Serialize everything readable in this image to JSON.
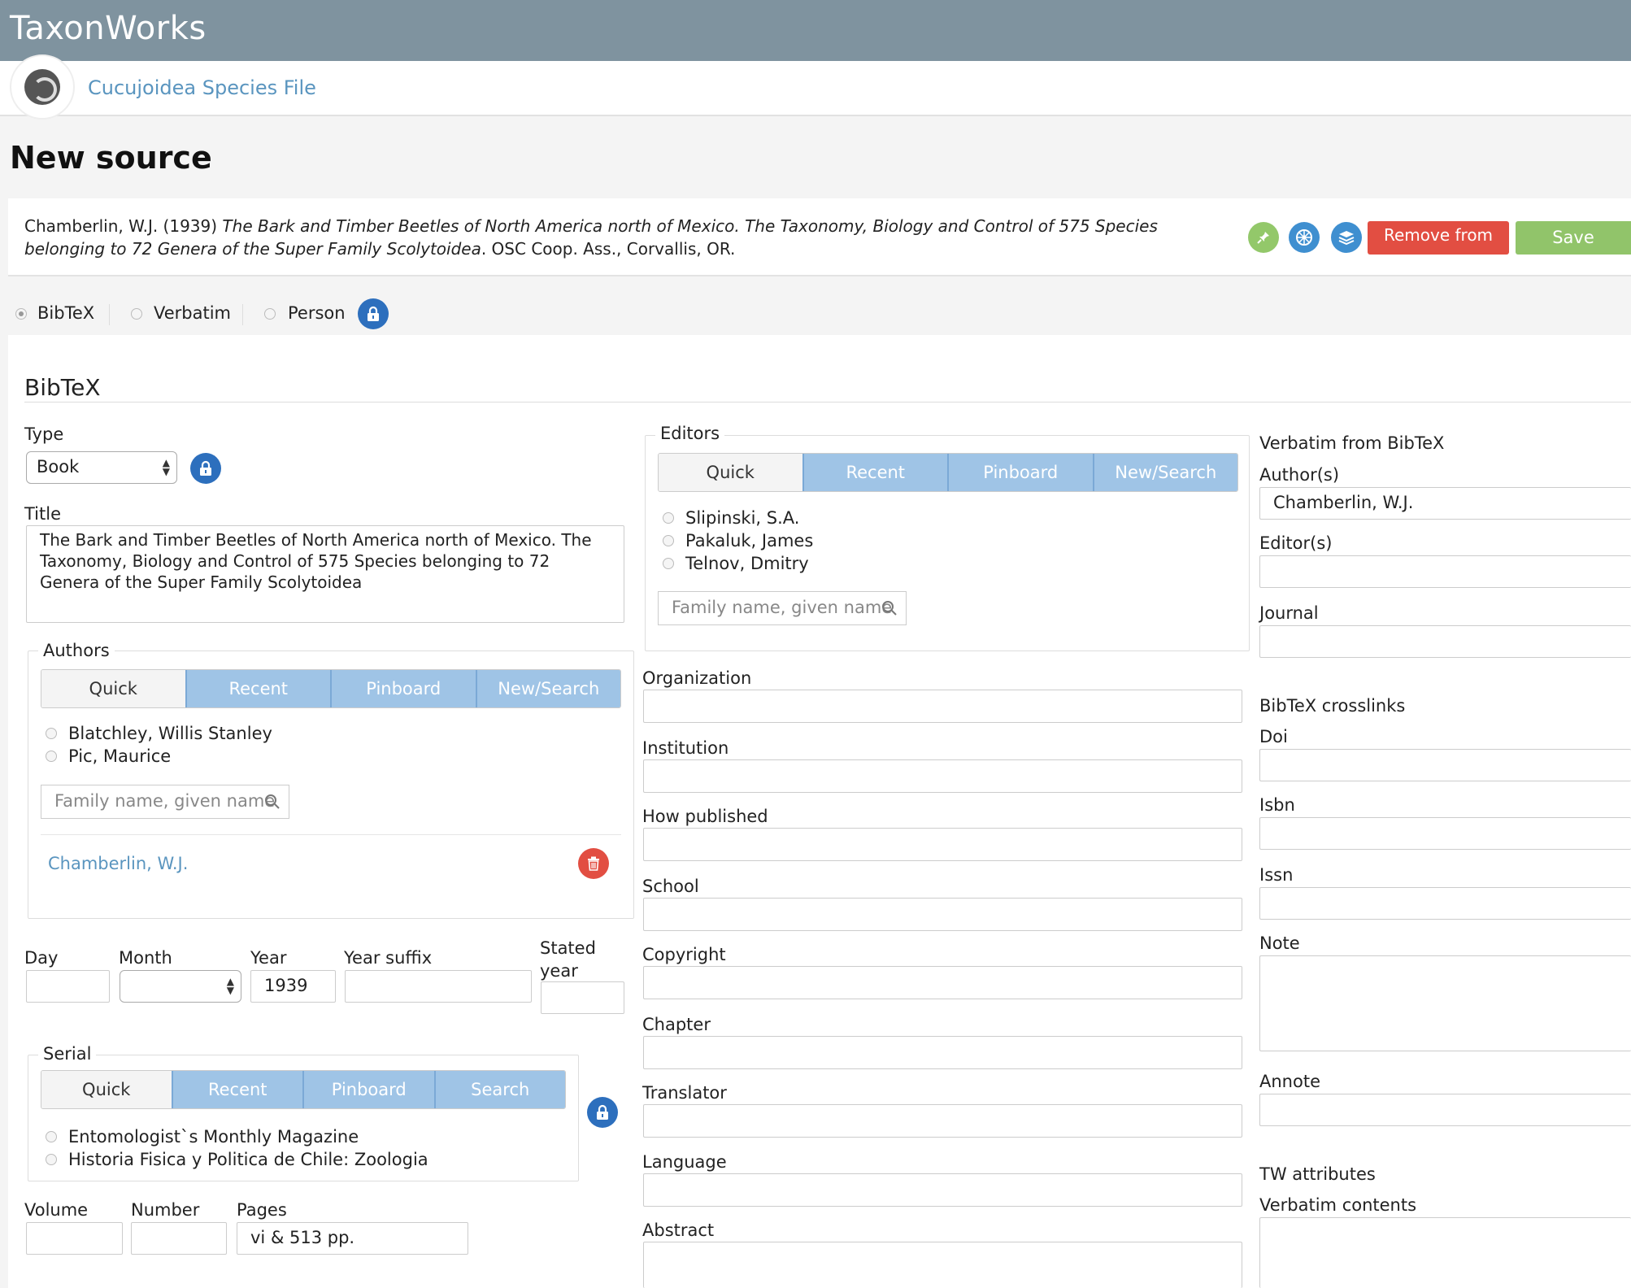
{
  "app": {
    "name": "TaxonWorks",
    "project": "Cucujoidea Species File"
  },
  "page_title": "New source",
  "citation": {
    "prefix": "Chamberlin, W.J. (1939) ",
    "title": "The Bark and Timber Beetles of North America north of Mexico. The Taxonomy, Biology and Control of 575 Species belonging to 72 Genera of the Super Family Scolytoidea",
    "suffix": ". OSC Coop. Ass., Corvallis, OR."
  },
  "actions": {
    "remove_label": "Remove from project",
    "save_label": "Save"
  },
  "source_types": {
    "bibtex": "BibTeX",
    "verbatim": "Verbatim",
    "person": "Person",
    "selected": "BibTeX"
  },
  "bibtex": {
    "section_title": "BibTeX",
    "type_label": "Type",
    "type_value": "Book",
    "title_label": "Title",
    "title_value": "The Bark and Timber Beetles of North America north of Mexico. The Taxonomy, Biology and Control of 575 Species belonging to 72 Genera of the Super Family Scolytoidea",
    "authors": {
      "legend": "Authors",
      "tabs": [
        "Quick",
        "Recent",
        "Pinboard",
        "New/Search"
      ],
      "options": [
        "Blatchley, Willis Stanley",
        "Pic, Maurice"
      ],
      "search_placeholder": "Family name, given name",
      "selected": [
        "Chamberlin, W.J."
      ]
    },
    "date": {
      "day_label": "Day",
      "day_value": "",
      "month_label": "Month",
      "month_value": "",
      "year_label": "Year",
      "year_value": "1939",
      "year_suffix_label": "Year suffix",
      "year_suffix_value": "",
      "stated_year_label_1": "Stated",
      "stated_year_label_2": "year",
      "stated_year_value": ""
    },
    "serial": {
      "legend": "Serial",
      "tabs": [
        "Quick",
        "Recent",
        "Pinboard",
        "Search"
      ],
      "options": [
        "Entomologist`s Monthly Magazine",
        "Historia Fisica y Politica de Chile: Zoologia"
      ]
    },
    "volume_label": "Volume",
    "volume_value": "",
    "number_label": "Number",
    "number_value": "",
    "pages_label": "Pages",
    "pages_value": "vi & 513 pp."
  },
  "editors": {
    "legend": "Editors",
    "tabs": [
      "Quick",
      "Recent",
      "Pinboard",
      "New/Search"
    ],
    "options": [
      "Slipinski, S.A.",
      "Pakaluk, James",
      "Telnov, Dmitry"
    ],
    "search_placeholder": "Family name, given name"
  },
  "middle_fields": [
    "Organization",
    "Institution",
    "How published",
    "School",
    "Copyright",
    "Chapter",
    "Translator",
    "Language",
    "Abstract"
  ],
  "verbatim_panel": {
    "title": "Verbatim from BibTeX",
    "authors_label": "Author(s)",
    "authors_value": "Chamberlin, W.J.",
    "editors_label": "Editor(s)",
    "journal_label": "Journal",
    "crosslinks_title": "BibTeX crosslinks",
    "doi_label": "Doi",
    "isbn_label": "Isbn",
    "issn_label": "Issn",
    "note_label": "Note",
    "annote_label": "Annote",
    "tw_title": "TW attributes",
    "verbatim_contents_label": "Verbatim contents"
  }
}
